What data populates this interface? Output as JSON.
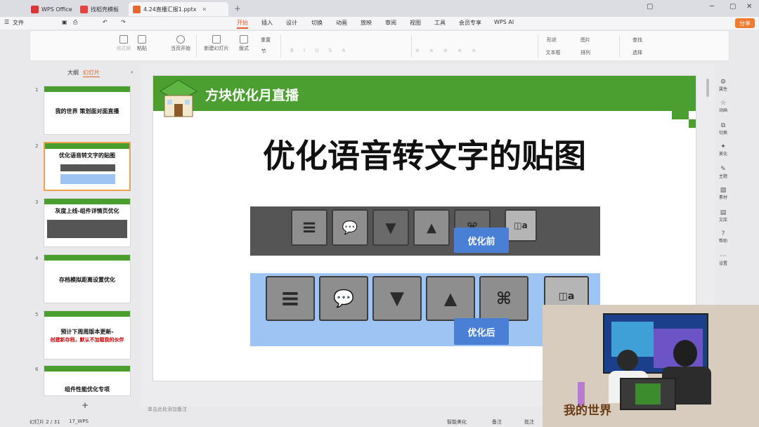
{
  "colors": {
    "accent": "#e25f2a",
    "slide_green": "#4b9f31",
    "label_blue": "#4a7fd6",
    "strip_after_bg": "#9ec4f4"
  },
  "tabs": [
    {
      "label": "WPS Office",
      "icon": "wps-logo-icon"
    },
    {
      "label": "找稻壳模板",
      "icon": "docer-icon"
    },
    {
      "label": "4.24直播汇报1.pptx",
      "icon": "pptx-file-icon",
      "active": true
    }
  ],
  "menu": {
    "file": "文件",
    "items": [
      "开始",
      "插入",
      "设计",
      "切换",
      "动画",
      "放映",
      "审阅",
      "视图",
      "工具",
      "会员专享",
      "WPS AI"
    ],
    "active": "开始",
    "share": "分享"
  },
  "ribbon": {
    "format_painter": "格式刷",
    "paste": "粘贴",
    "play_current": "当页开始",
    "new_slide": "新建幻灯片",
    "layout": "版式",
    "section": "节",
    "reset": "重置",
    "shapes": "形状",
    "picture": "图片",
    "textbox": "文本框",
    "arrange": "排列",
    "find": "查找",
    "select": "选择"
  },
  "left_pane": {
    "tabs": [
      "大纲",
      "幻灯片"
    ],
    "active_tab": "幻灯片",
    "slides": [
      {
        "num": "1",
        "title": "我的世界 策划面对面直播",
        "sub": ""
      },
      {
        "num": "2",
        "title": "优化语音转文字的贴图",
        "sub": ""
      },
      {
        "num": "3",
        "title": "灰度上线-组件详情页优化",
        "sub": ""
      },
      {
        "num": "4",
        "title": "存档模拟距离设置优化",
        "sub": ""
      },
      {
        "num": "5",
        "title": "预计下周周版本更新-",
        "sub": "创建新存档，默认不加载我的伙伴"
      },
      {
        "num": "6",
        "title": "组件性能优化专项",
        "sub": ""
      }
    ],
    "add": "+"
  },
  "slide": {
    "header": "方块优化月直播",
    "title": "优化语音转文字的贴图",
    "before_label": "优化前",
    "after_label": "优化后"
  },
  "notes_placeholder": "单击此处添加备注",
  "status": {
    "slide_pos": "幻灯片 2 / 31",
    "theme": "17_WPS",
    "smart": "智能美化",
    "notes": "备注",
    "comment": "批注"
  },
  "right_bar": [
    "属性",
    "动画",
    "切换",
    "美化",
    "主题",
    "素材",
    "文库",
    "帮助",
    "设置"
  ],
  "cam_overlay": "我的世界"
}
